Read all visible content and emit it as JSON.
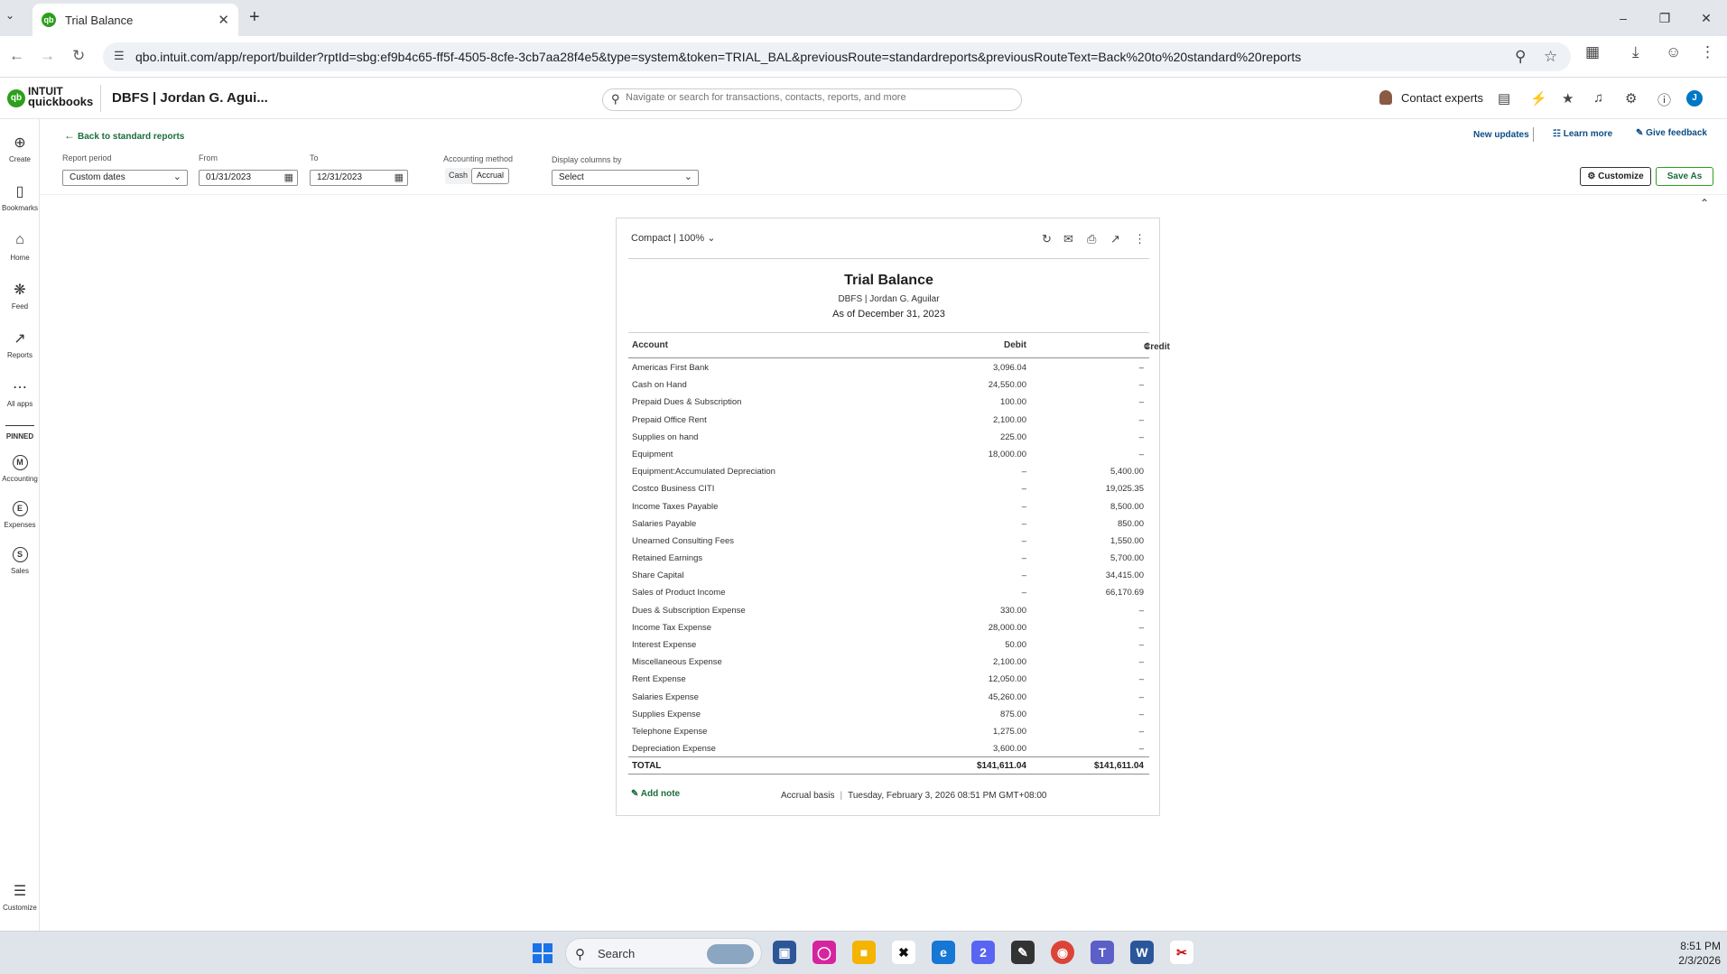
{
  "browser": {
    "tab_title": "Trial Balance",
    "url": "qbo.intuit.com/app/report/builder?rptId=sbg:ef9b4c65-ff5f-4505-8cfe-3cb7aa28f4e5&type=system&token=TRIAL_BAL&previousRoute=standardreports&previousRouteText=Back%20to%20standard%20reports"
  },
  "header": {
    "logo_top": "INTUIT",
    "logo_bottom": "quickbooks",
    "company": "DBFS | Jordan G. Agui...",
    "search_placeholder": "Navigate or search for transactions, contacts, reports, and more",
    "contact_experts": "Contact experts",
    "user_initial": "J"
  },
  "leftnav": {
    "items": [
      {
        "label": "Create",
        "icon": "plus-circle-icon"
      },
      {
        "label": "Bookmarks",
        "icon": "bookmark-icon"
      },
      {
        "label": "Home",
        "icon": "home-icon"
      },
      {
        "label": "Feed",
        "icon": "feed-icon"
      },
      {
        "label": "Reports",
        "icon": "chart-icon"
      },
      {
        "label": "All apps",
        "icon": "grid-icon"
      }
    ],
    "pinned_label": "PINNED",
    "pinned": [
      {
        "label": "Accounting",
        "glyph": "M"
      },
      {
        "label": "Expenses",
        "glyph": "E"
      },
      {
        "label": "Sales",
        "glyph": "S"
      }
    ],
    "customize": "Customize"
  },
  "toolbar": {
    "back_link": "Back to standard reports",
    "report_period_label": "Report period",
    "report_period_value": "Custom dates",
    "from_label": "From",
    "from_value": "01/31/2023",
    "to_label": "To",
    "to_value": "12/31/2023",
    "method_label": "Accounting method",
    "method_cash": "Cash",
    "method_accrual": "Accrual",
    "display_columns_label": "Display columns by",
    "display_columns_value": "Select",
    "new_updates": "New updates",
    "learn_more": "Learn more",
    "give_feedback": "Give feedback",
    "customize": "Customize",
    "save_as": "Save As"
  },
  "report": {
    "view": "Compact | 100%",
    "title": "Trial Balance",
    "company": "DBFS | Jordan G. Aguilar",
    "as_of": "As of December 31, 2023",
    "columns": {
      "account": "Account",
      "debit": "Debit",
      "credit": "Credit"
    },
    "rows": [
      {
        "account": "Americas First Bank",
        "debit": "3,096.04",
        "credit": "–"
      },
      {
        "account": "Cash on Hand",
        "debit": "24,550.00",
        "credit": "–"
      },
      {
        "account": "Prepaid Dues & Subscription",
        "debit": "100.00",
        "credit": "–"
      },
      {
        "account": "Prepaid Office Rent",
        "debit": "2,100.00",
        "credit": "–"
      },
      {
        "account": "Supplies on hand",
        "debit": "225.00",
        "credit": "–"
      },
      {
        "account": "Equipment",
        "debit": "18,000.00",
        "credit": "–"
      },
      {
        "account": "Equipment:Accumulated Depreciation",
        "debit": "–",
        "credit": "5,400.00"
      },
      {
        "account": "Costco Business CITI",
        "debit": "–",
        "credit": "19,025.35"
      },
      {
        "account": "Income Taxes Payable",
        "debit": "–",
        "credit": "8,500.00"
      },
      {
        "account": "Salaries Payable",
        "debit": "–",
        "credit": "850.00"
      },
      {
        "account": "Unearned Consulting Fees",
        "debit": "–",
        "credit": "1,550.00"
      },
      {
        "account": "Retained Earnings",
        "debit": "–",
        "credit": "5,700.00"
      },
      {
        "account": "Share Capital",
        "debit": "–",
        "credit": "34,415.00"
      },
      {
        "account": "Sales of Product Income",
        "debit": "–",
        "credit": "66,170.69"
      },
      {
        "account": "Dues & Subscription Expense",
        "debit": "330.00",
        "credit": "–"
      },
      {
        "account": "Income Tax Expense",
        "debit": "28,000.00",
        "credit": "–"
      },
      {
        "account": "Interest Expense",
        "debit": "50.00",
        "credit": "–"
      },
      {
        "account": "Miscellaneous Expense",
        "debit": "2,100.00",
        "credit": "–"
      },
      {
        "account": "Rent Expense",
        "debit": "12,050.00",
        "credit": "–"
      },
      {
        "account": "Salaries Expense",
        "debit": "45,260.00",
        "credit": "–"
      },
      {
        "account": "Supplies Expense",
        "debit": "875.00",
        "credit": "–"
      },
      {
        "account": "Telephone Expense",
        "debit": "1,275.00",
        "credit": "–"
      },
      {
        "account": "Depreciation Expense",
        "debit": "3,600.00",
        "credit": "–"
      }
    ],
    "total": {
      "label": "TOTAL",
      "debit": "$141,611.04",
      "credit": "$141,611.04"
    },
    "add_note": "Add note",
    "basis": "Accrual basis",
    "timestamp": "Tuesday, February 3, 2026 08:51 PM GMT+08:00"
  },
  "taskbar": {
    "search": "Search",
    "time": "8:51 PM",
    "date": "2/3/2026",
    "discord_badge": "2"
  },
  "colors": {
    "qb_green": "#2ca01c",
    "link_blue": "#0d4d86",
    "dark_green": "#1b6d3a"
  }
}
